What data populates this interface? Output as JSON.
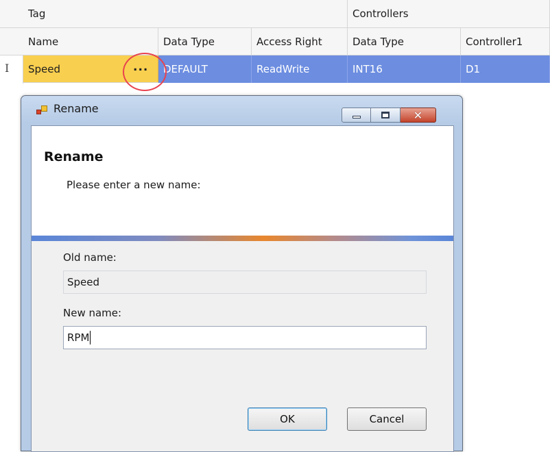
{
  "grid": {
    "group_headers": {
      "tag": "Tag",
      "controllers": "Controllers"
    },
    "column_headers": {
      "name": "Name",
      "data_type": "Data Type",
      "access_right": "Access Right",
      "ctrl_data_type": "Data Type",
      "controller1": "Controller1"
    },
    "row": {
      "cursor_glyph": "I",
      "name": "Speed",
      "ellipsis": "...",
      "data_type": "DEFAULT",
      "access_right": "ReadWrite",
      "ctrl_data_type": "INT16",
      "controller1": "D1"
    }
  },
  "dialog": {
    "title": "Rename",
    "heading": "Rename",
    "prompt": "Please enter a new name:",
    "old_name_label": "Old name:",
    "old_name_value": "Speed",
    "new_name_label": "New name:",
    "new_name_value": "RPM",
    "ok_label": "OK",
    "cancel_label": "Cancel",
    "close_glyph": "✕"
  },
  "colors": {
    "selected_row": "#6c8de0",
    "selected_cell": "#f9cf4f",
    "highlight_circle": "#e8434e",
    "accent_orange": "#e8872e"
  }
}
